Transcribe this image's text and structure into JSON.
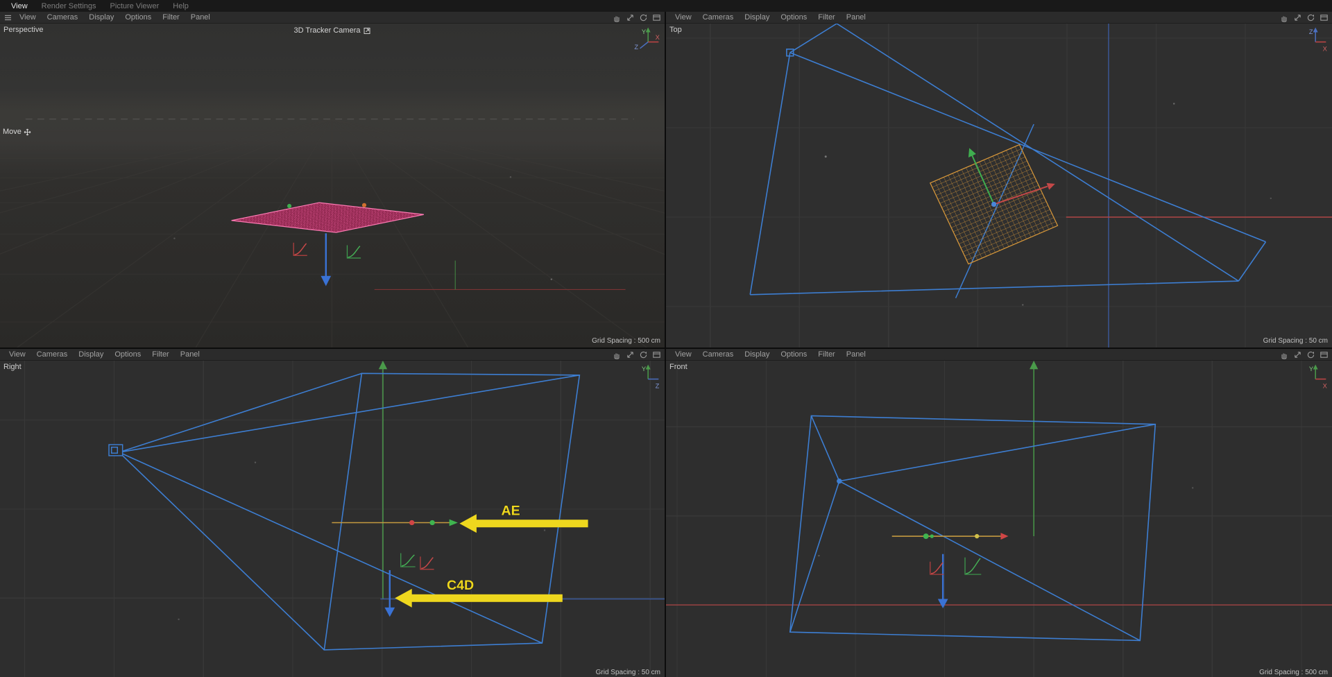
{
  "global_menu": {
    "items": [
      "View",
      "Render Settings",
      "Picture Viewer",
      "Help"
    ]
  },
  "viewport_menu": {
    "items": [
      "View",
      "Cameras",
      "Display",
      "Options",
      "Filter",
      "Panel"
    ]
  },
  "toolbar_icons": [
    "pan-view",
    "zoom-view",
    "rotate-view",
    "toggle-view"
  ],
  "viewports": {
    "perspective": {
      "label": "Perspective",
      "camera_label": "3D Tracker Camera",
      "tool_hint": "Move",
      "grid_spacing": "Grid Spacing : 500 cm",
      "axis_widget": {
        "up": "Y",
        "right": "X",
        "third": "Z"
      }
    },
    "top": {
      "label": "Top",
      "grid_spacing": "Grid Spacing : 50 cm",
      "axis_widget": {
        "up": "Z",
        "right": "X"
      }
    },
    "right": {
      "label": "Right",
      "grid_spacing": "Grid Spacing : 50 cm",
      "annotations": {
        "ae": "AE",
        "c4d": "C4D"
      },
      "axis_widget": {
        "up": "Y",
        "right": "Z"
      }
    },
    "front": {
      "label": "Front",
      "grid_spacing": "Grid Spacing : 500 cm",
      "axis_widget": {
        "up": "Y",
        "right": "X"
      }
    }
  },
  "colors": {
    "frustum_blue": "#3d7ed2",
    "annotation_yellow": "#eed71e",
    "plane_pink_lines": "#ff6aac",
    "plane_orange_lines": "#d6973a",
    "axis_x_red": "#b04646",
    "axis_y_green": "#4a9a4a",
    "axis_z_blue": "#3c5fa8",
    "gizmo_orange": "#c49a40"
  }
}
